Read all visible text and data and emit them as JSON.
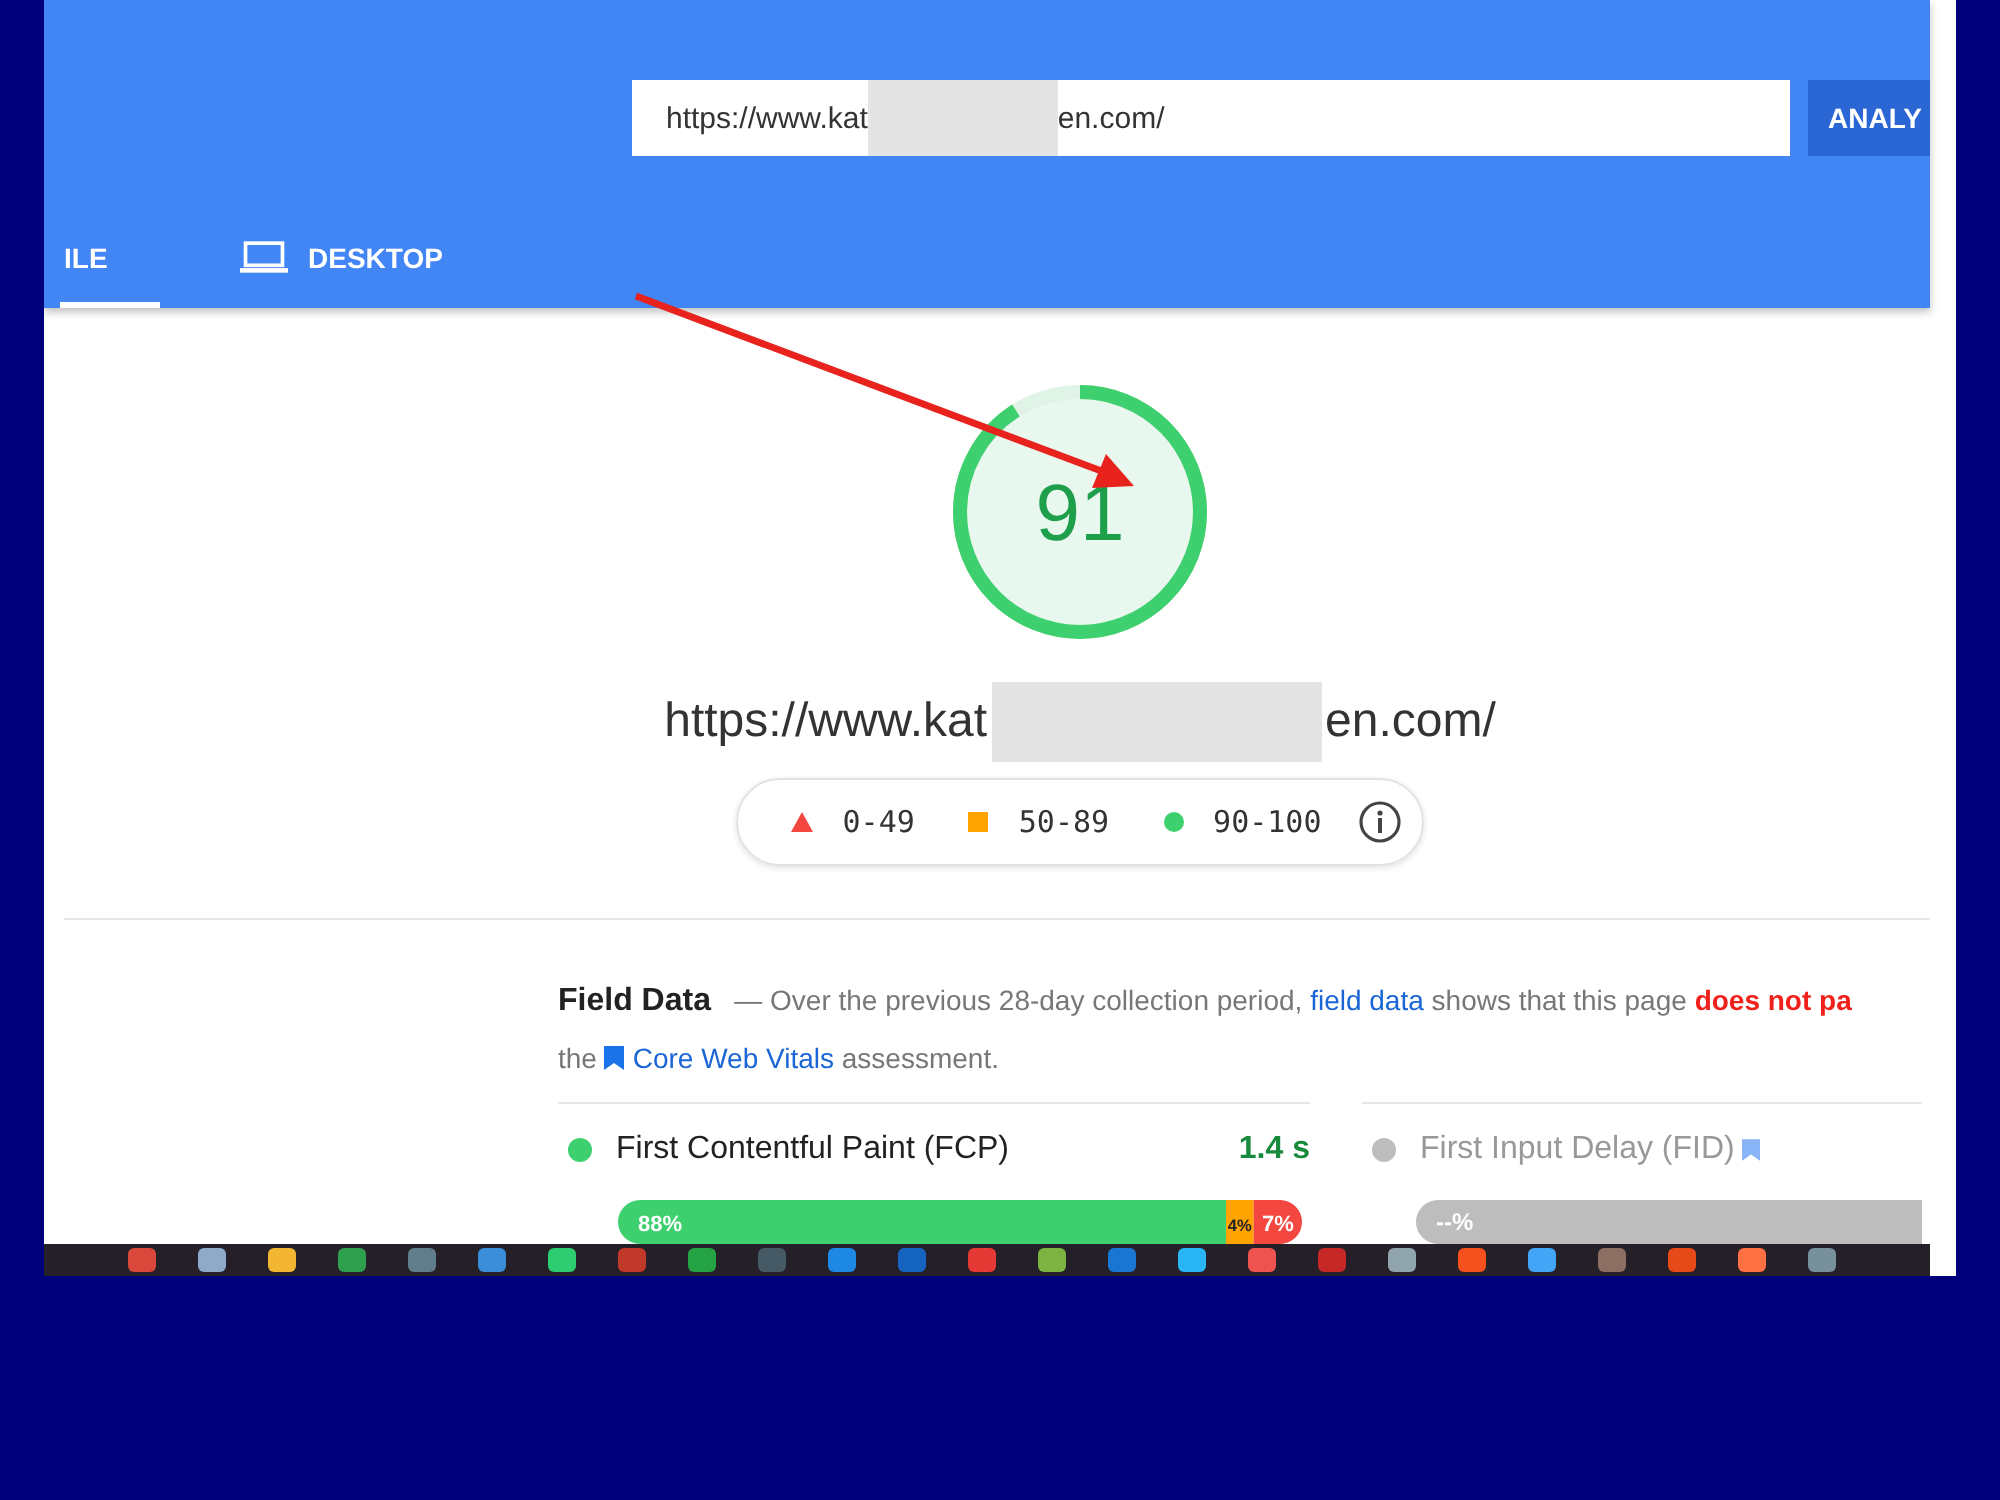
{
  "search": {
    "value": "https://www.kat",
    "value_end": "en.com/",
    "button": "ANALY"
  },
  "tabs": [
    {
      "label": "ILE",
      "selected": true,
      "kind": "phone"
    },
    {
      "label": "DESKTOP",
      "selected": false,
      "kind": "laptop"
    }
  ],
  "score": {
    "value": "91",
    "level": 0.91,
    "url_start": "https://www.kat",
    "url_end": "en.com/"
  },
  "legend": [
    {
      "kind": "fail",
      "label": "0-49"
    },
    {
      "kind": "average",
      "label": "50-89"
    },
    {
      "kind": "pass",
      "label": "90-100"
    }
  ],
  "field_data": {
    "title": "Field Data",
    "intro": "— Over the previous 28-day collection period,",
    "link": "field data",
    "middle": "shows that this page",
    "verdict": "does not pa",
    "line2_start": "the",
    "cwv_link": "Core Web Vitals",
    "line2_end": "assessment."
  },
  "metrics": [
    {
      "name": "First Contentful Paint (FCP)",
      "value": "1.4 s",
      "disabled": false,
      "chart_data": {
        "type": "bar",
        "orientation": "horizontal",
        "stacked": true,
        "data_labels": true,
        "series": [
          {
            "color": "#3ecf6e",
            "values": [
              88
            ],
            "value_labels": [
              "88%"
            ]
          },
          {
            "color": "#ffa400",
            "values": [
              4
            ],
            "value_labels": [
              "4%"
            ]
          },
          {
            "color": "#f4473f",
            "values": [
              7
            ],
            "value_labels": [
              "7%"
            ]
          }
        ]
      }
    },
    {
      "name": "First Input Delay (FID)",
      "disabled": true,
      "bar_label": "--%"
    }
  ]
}
